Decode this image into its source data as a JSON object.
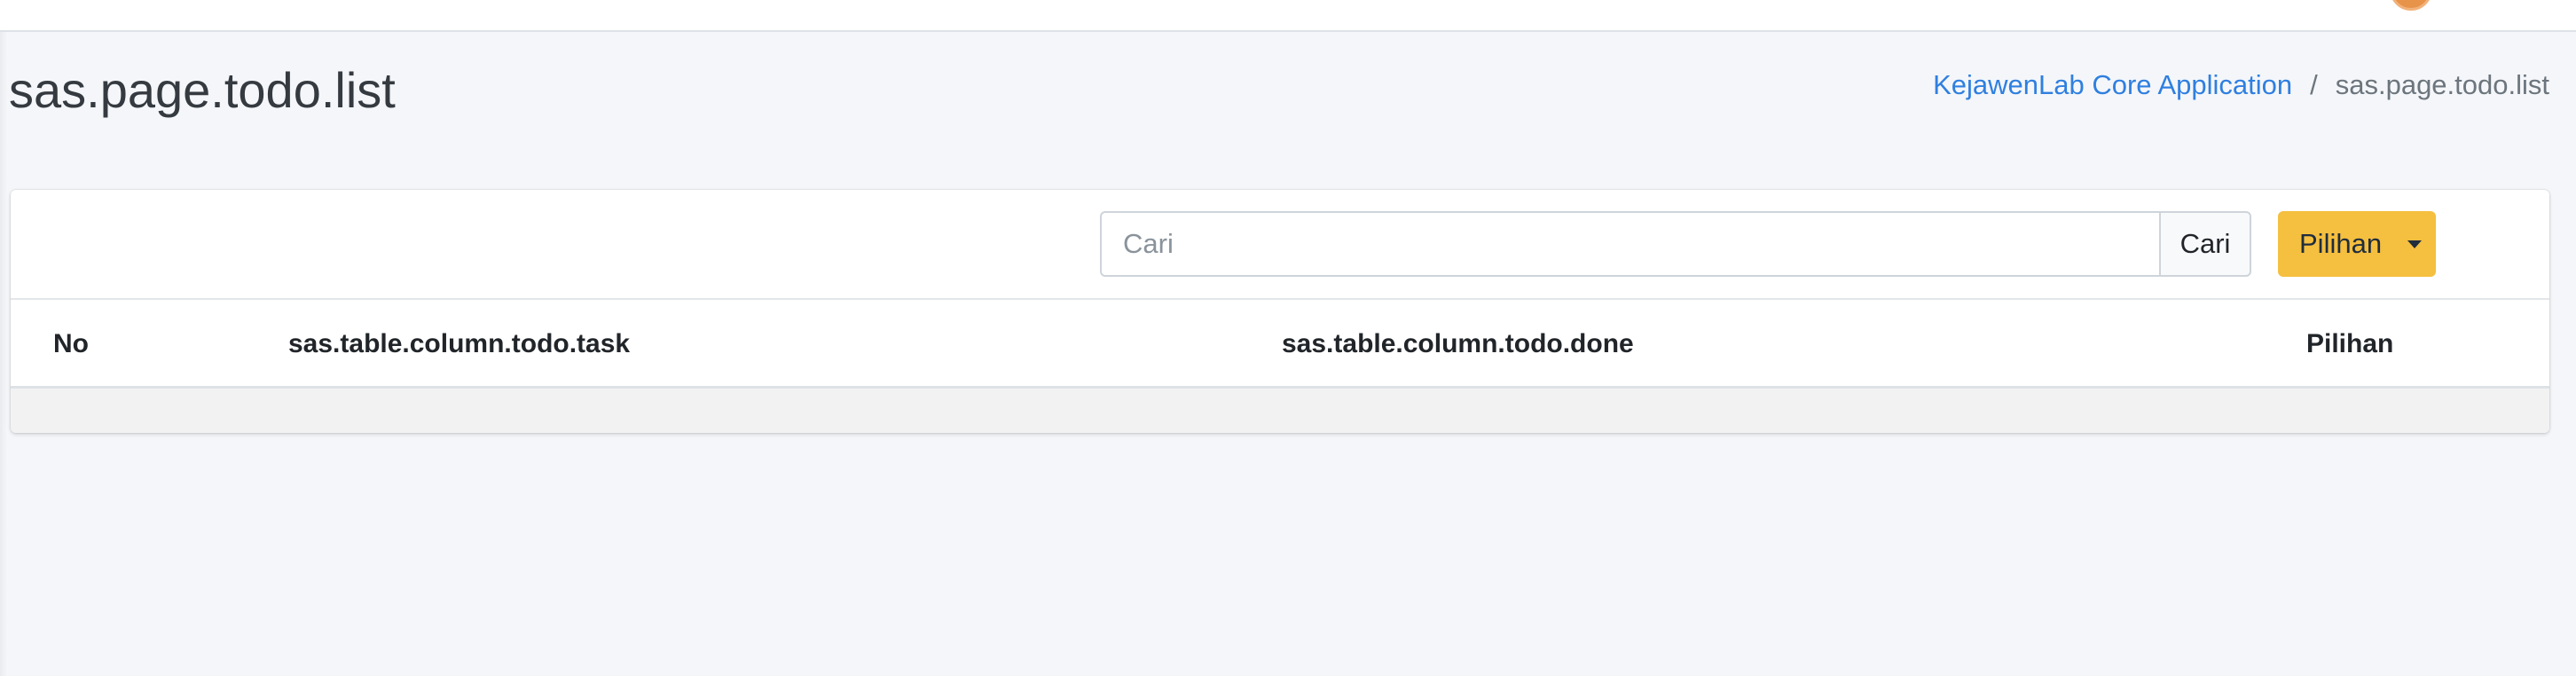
{
  "header": {
    "title": "sas.page.todo.list",
    "breadcrumb": {
      "home": "KejawenLab Core Application",
      "separator": "/",
      "current": "sas.page.todo.list"
    }
  },
  "toolbar": {
    "search_placeholder": "Cari",
    "search_button": "Cari",
    "options_button": "Pilihan"
  },
  "table": {
    "columns": [
      "No",
      "sas.table.column.todo.task",
      "sas.table.column.todo.done",
      "Pilihan"
    ],
    "rows": []
  },
  "colors": {
    "background": "#f4f6f9",
    "link": "#2f7fe0",
    "options_button": "#f5bf3f"
  },
  "icons": {
    "options_caret": "caret-down-icon"
  }
}
